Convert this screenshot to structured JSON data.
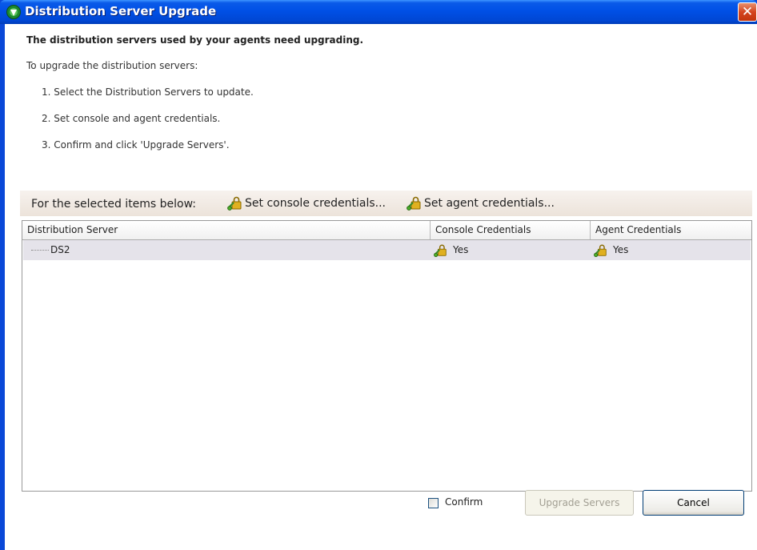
{
  "window": {
    "title": "Distribution Server Upgrade",
    "close_glyph": "✕",
    "app_icon": "green-shield-icon"
  },
  "content": {
    "heading": "The distribution servers used by your agents need upgrading.",
    "intro": "To upgrade the distribution servers:",
    "steps": [
      "1. Select the Distribution Servers to update.",
      "2. Set console and agent credentials.",
      "3. Confirm and click 'Upgrade Servers'."
    ]
  },
  "action_bar": {
    "label": "For the selected items below:",
    "set_console": "Set console credentials...",
    "set_agent": "Set agent credentials...",
    "icon": "key-lock-icon"
  },
  "grid": {
    "columns": [
      "Distribution Server",
      "Console Credentials",
      "Agent Credentials"
    ],
    "rows": [
      {
        "server": "DS2",
        "console": "Yes",
        "agent": "Yes"
      }
    ]
  },
  "footer": {
    "confirm_label": "Confirm",
    "confirm_checked": false,
    "upgrade_label": "Upgrade Servers",
    "cancel_label": "Cancel"
  },
  "colors": {
    "titlebar": "#0050e6",
    "close": "#d4451f",
    "row_selected": "#e5e3ea"
  }
}
